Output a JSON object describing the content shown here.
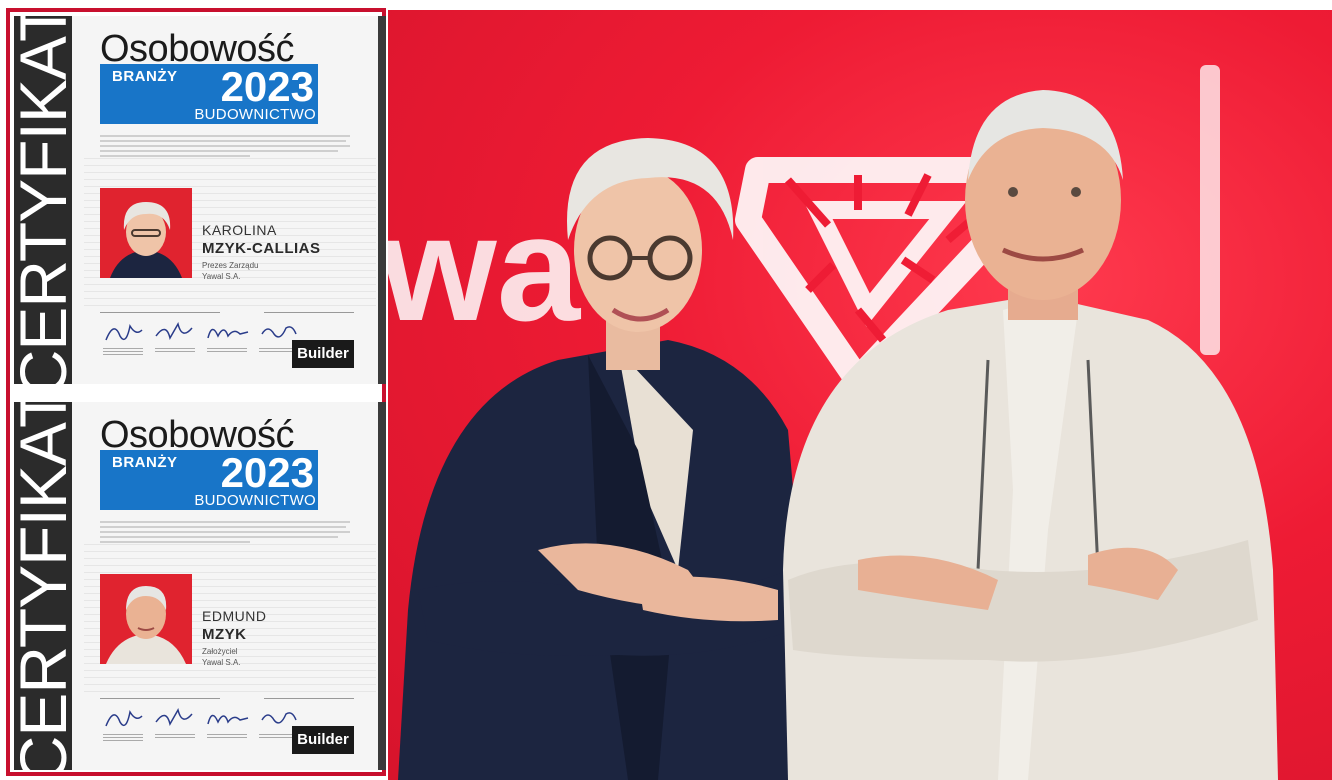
{
  "certificates": [
    {
      "spine": "CERTYFIKAT",
      "logo": {
        "word": "Osobowość",
        "branzy": "BRANŻY",
        "year": "2023",
        "sector": "BUDOWNICTWO"
      },
      "person": {
        "first_name": "KAROLINA",
        "last_name": "MZYK-CALLIAS",
        "role": "Prezes Zarządu",
        "company": "Yawal S.A."
      },
      "badge": "Builder"
    },
    {
      "spine": "CERTYFIKAT",
      "logo": {
        "word": "Osobowość",
        "branzy": "BRANŻY",
        "year": "2023",
        "sector": "BUDOWNICTWO"
      },
      "person": {
        "first_name": "EDMUND",
        "last_name": "MZYK",
        "role": "Założyciel",
        "company": "Yawal S.A."
      },
      "badge": "Builder"
    }
  ],
  "photo": {
    "wall_text": "wa",
    "colors": {
      "wall": "#ee1b34",
      "jacket_left": "#1c2540",
      "jacket_right": "#e9e4dc",
      "hair": "#e8e6e1"
    }
  }
}
